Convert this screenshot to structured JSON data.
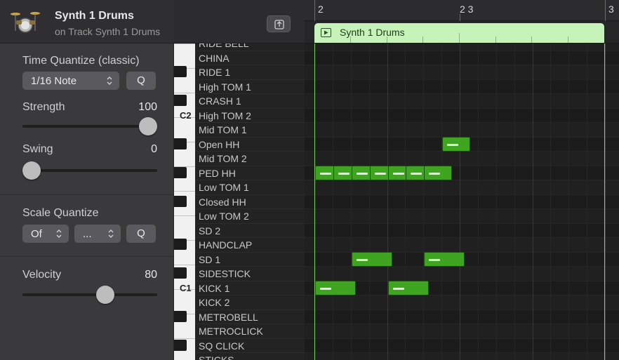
{
  "track": {
    "name": "Synth 1 Drums",
    "subtitle": "on Track Synth 1 Drums",
    "icon": "drum-kit-icon"
  },
  "time_quantize": {
    "title": "Time Quantize (classic)",
    "value": "1/16 Note",
    "q_label": "Q",
    "strength_label": "Strength",
    "strength_value": "100",
    "strength_level": 1.0,
    "swing_label": "Swing",
    "swing_value": "0",
    "swing_level": 0.0
  },
  "scale_quantize": {
    "title": "Scale Quantize",
    "root_value": "Of",
    "scale_value": "...",
    "q_label": "Q"
  },
  "velocity": {
    "label": "Velocity",
    "value": "80",
    "level": 0.63
  },
  "keyboard": {
    "c_labels": [
      "C2",
      "C1"
    ]
  },
  "ruler": {
    "labels": [
      "2",
      "2 3",
      "3"
    ]
  },
  "region": {
    "name": "Synth 1 Drums",
    "color": "#c6f3ba",
    "icon": "play-icon"
  },
  "note_color": "#3fa521",
  "drum_names": [
    "RIDE BELL",
    "CHINA",
    "RIDE 1",
    "High TOM 1",
    "CRASH 1",
    "High TOM 2",
    "Mid TOM 1",
    "Open HH",
    "Mid TOM 2",
    "PED HH",
    "Low TOM 1",
    "Closed HH",
    "Low TOM 2",
    "SD 2",
    "HANDCLAP",
    "SD 1",
    "SIDESTICK",
    "KICK 1",
    "KICK 2",
    "METROBELL",
    "METROCLICK",
    "SQ CLICK",
    "STICKS"
  ],
  "notes": [
    {
      "pitch": "Open HH",
      "start": 2.4375,
      "length": 0.0625
    },
    {
      "pitch": "PED HH",
      "start": 2.0,
      "length": 0.0625
    },
    {
      "pitch": "PED HH",
      "start": 2.0625,
      "length": 0.0625
    },
    {
      "pitch": "PED HH",
      "start": 2.125,
      "length": 0.0625
    },
    {
      "pitch": "PED HH",
      "start": 2.1875,
      "length": 0.0625
    },
    {
      "pitch": "PED HH",
      "start": 2.25,
      "length": 0.0625
    },
    {
      "pitch": "PED HH",
      "start": 2.3125,
      "length": 0.0625
    },
    {
      "pitch": "PED HH",
      "start": 2.375,
      "length": 0.0625
    },
    {
      "pitch": "SD 1",
      "start": 2.125,
      "length": 0.0625
    },
    {
      "pitch": "SD 1",
      "start": 2.375,
      "length": 0.0625
    },
    {
      "pitch": "KICK 1",
      "start": 2.0,
      "length": 0.0625
    },
    {
      "pitch": "KICK 1",
      "start": 2.25,
      "length": 0.0625
    }
  ]
}
